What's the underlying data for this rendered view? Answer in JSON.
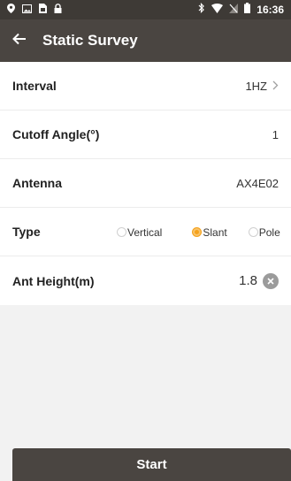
{
  "status_bar": {
    "time": "16:36",
    "left_icons": [
      "location-pin-icon",
      "image-icon",
      "sim-icon",
      "lock-icon"
    ],
    "right_icons": [
      "bluetooth-icon",
      "wifi-icon",
      "no-sim-icon",
      "battery-icon"
    ]
  },
  "app_bar": {
    "title": "Static Survey",
    "back_icon": "arrow-left-icon"
  },
  "form": {
    "interval": {
      "label": "Interval",
      "value": "1HZ"
    },
    "cutoff_angle": {
      "label": "Cutoff Angle(°)",
      "value": "1"
    },
    "antenna": {
      "label": "Antenna",
      "value": "AX4E02"
    },
    "type": {
      "label": "Type",
      "options": [
        "Vertical",
        "Slant",
        "Pole"
      ],
      "selected": "Slant"
    },
    "ant_height": {
      "label": "Ant Height(m)",
      "value": "1.8"
    }
  },
  "start_button": {
    "label": "Start"
  },
  "colors": {
    "app_bar": "#4a4541",
    "status_bar": "#3e3a36",
    "accent": "#f5a21c",
    "background": "#f2f2f2"
  }
}
